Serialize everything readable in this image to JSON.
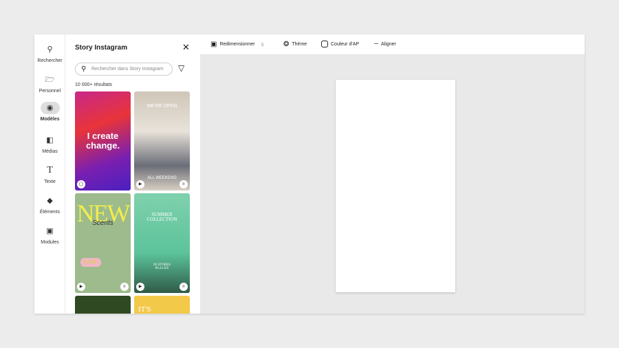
{
  "rail": [
    {
      "label": "Rechercher",
      "icon": "search-icon"
    },
    {
      "label": "Personnel",
      "icon": "folder-icon"
    },
    {
      "label": "Modèles",
      "icon": "templates-icon",
      "active": true
    },
    {
      "label": "Médias",
      "icon": "media-icon"
    },
    {
      "label": "Texte",
      "icon": "text-icon"
    },
    {
      "label": "Éléments",
      "icon": "elements-icon"
    },
    {
      "label": "Modules",
      "icon": "modules-icon"
    }
  ],
  "panel": {
    "title": "Story Instagram",
    "search_placeholder": "Rechercher dans Story Instagram",
    "results": "10 000+ résultats",
    "templates": [
      {
        "lines": [
          "I create",
          "change."
        ]
      },
      {
        "lines": [
          "WE'RE OPEN",
          "ALL WEEKEND"
        ]
      },
      {
        "lines": [
          "NEW",
          "Scents",
          "07.23"
        ]
      },
      {
        "lines": [
          "SUMMER",
          "COLLECTION",
          "IN STORES",
          "06.24.XX"
        ]
      },
      {
        "lines": [
          ""
        ]
      },
      {
        "lines": [
          "IT'S"
        ]
      }
    ]
  },
  "toolbar": {
    "resize": "Redimensionner",
    "theme": "Thème",
    "bg_color": "Couleur d'AP",
    "align": "Aligner"
  }
}
